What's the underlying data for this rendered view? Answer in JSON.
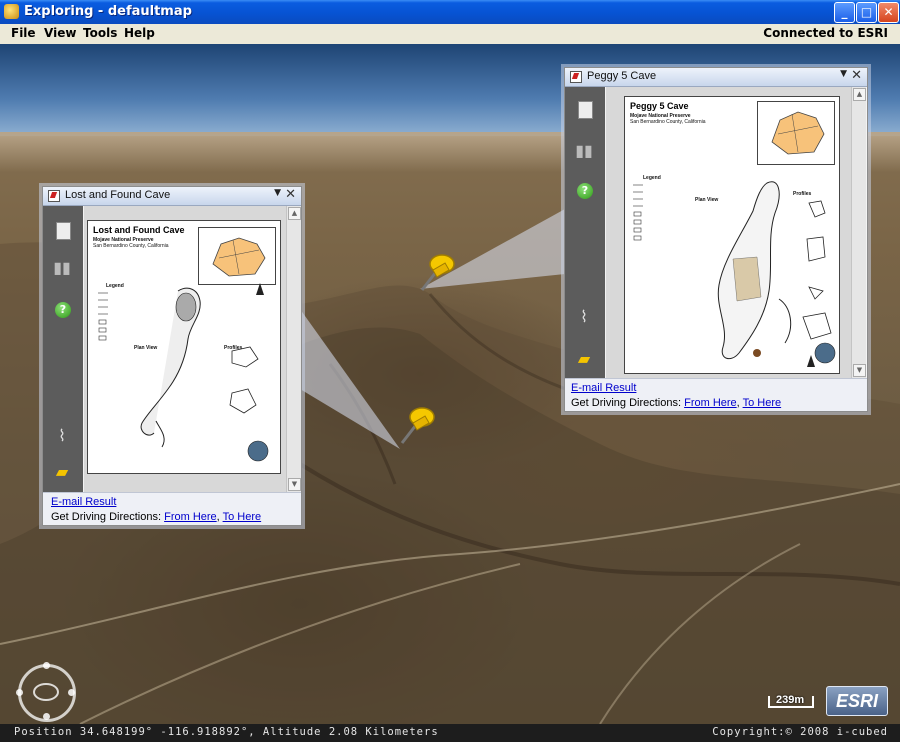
{
  "window": {
    "title": "Exploring - defaultmap",
    "minimize": "_",
    "maximize": "□",
    "close": "✕"
  },
  "menu": {
    "items": [
      "File",
      "View",
      "Tools",
      "Help"
    ],
    "connection_status": "Connected to ESRI"
  },
  "popups": [
    {
      "title": "Lost and Found Cave",
      "doc_title": "Lost and Found Cave",
      "doc_subtitle_1": "Mojave National Preserve",
      "doc_subtitle_2": "San Bernardino County, California",
      "legend_label": "Legend",
      "plan_view_label": "Plan View",
      "profiles_label": "Profiles",
      "email_link": "E-mail Result",
      "driving_label": "Get Driving Directions:",
      "from_here": "From Here",
      "to_here": "To Here"
    },
    {
      "title": "Peggy 5 Cave",
      "doc_title": "Peggy 5 Cave",
      "doc_subtitle_1": "Mojave National Preserve",
      "doc_subtitle_2": "San Bernardino County, California",
      "legend_label": "Legend",
      "plan_view_label": "Plan View",
      "profiles_label": "Profiles",
      "email_link": "E-mail Result",
      "driving_label": "Get Driving Directions:",
      "from_here": "From Here",
      "to_here": "To Here"
    }
  ],
  "icons": {
    "toolbar": [
      "document-icon",
      "binoculars-icon",
      "help-icon",
      "paperclip-icon",
      "chat-icon"
    ],
    "map": [
      "pushpin-icon",
      "navigation-ring-icon",
      "esri-logo"
    ]
  },
  "map": {
    "scale_label": "239m",
    "logo_text": "ESRI"
  },
  "status": {
    "position": "Position 34.648199°  -116.918892°, Altitude  2.08 Kilometers",
    "copyright": "Copyright:© 2008 i-cubed"
  },
  "colors": {
    "titlebar": "#0753d3",
    "link": "#0000cc",
    "pushpin": "#f5c800",
    "sky": "#4f7cb0"
  }
}
